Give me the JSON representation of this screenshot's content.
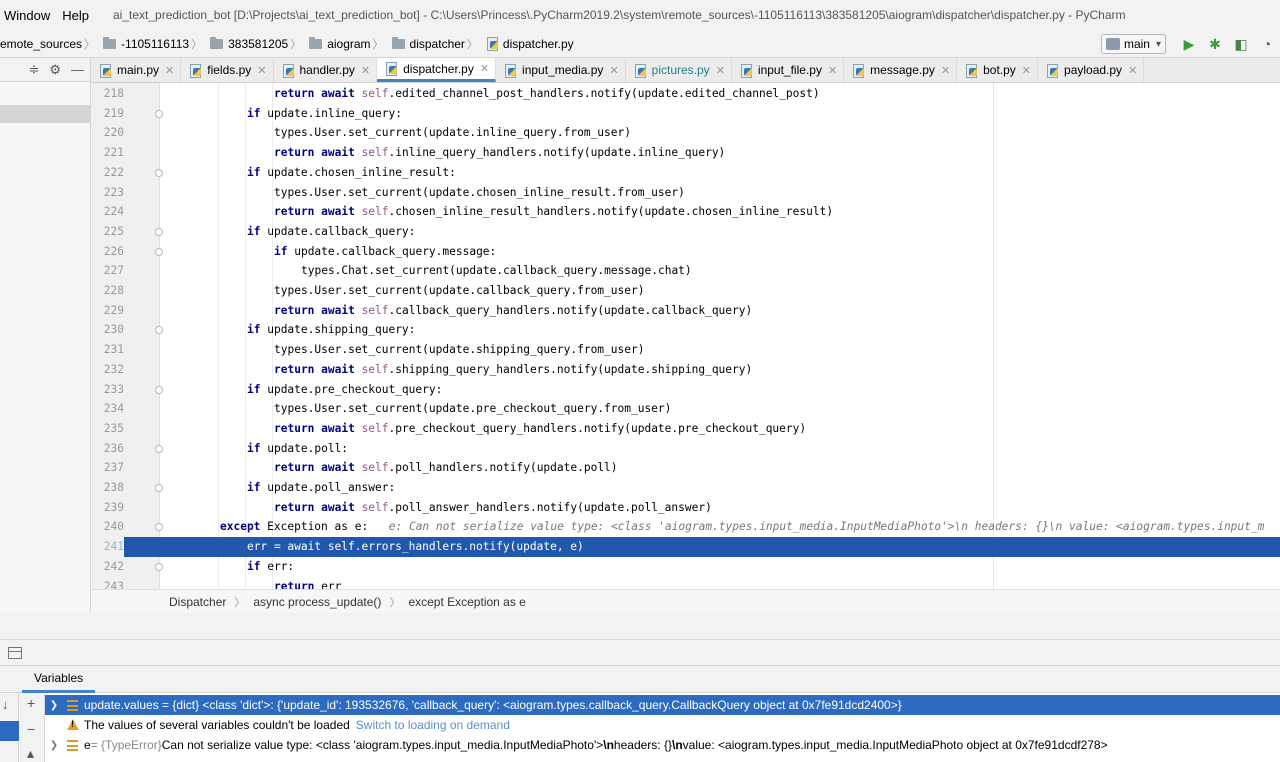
{
  "menu": {
    "items": [
      "Window",
      "Help"
    ],
    "window_title": "ai_text_prediction_bot [D:\\Projects\\ai_text_prediction_bot] - C:\\Users\\Princess\\.PyCharm2019.2\\system\\remote_sources\\-1105116113\\383581205\\aiogram\\dispatcher\\dispatcher.py - PyCharm"
  },
  "nav": {
    "crumbs": [
      "emote_sources",
      "-1105116113",
      "383581205",
      "aiogram",
      "dispatcher",
      "dispatcher.py"
    ],
    "branch": "main"
  },
  "tabs": [
    {
      "label": "main.py",
      "active": false,
      "cyan": false
    },
    {
      "label": "fields.py",
      "active": false,
      "cyan": false
    },
    {
      "label": "handler.py",
      "active": false,
      "cyan": false
    },
    {
      "label": "dispatcher.py",
      "active": true,
      "cyan": false
    },
    {
      "label": "input_media.py",
      "active": false,
      "cyan": false
    },
    {
      "label": "pictures.py",
      "active": false,
      "cyan": true
    },
    {
      "label": "input_file.py",
      "active": false,
      "cyan": false
    },
    {
      "label": "message.py",
      "active": false,
      "cyan": false
    },
    {
      "label": "bot.py",
      "active": false,
      "cyan": false
    },
    {
      "label": "payload.py",
      "active": false,
      "cyan": false
    }
  ],
  "code": {
    "current_line": 241,
    "lines": [
      {
        "n": 218,
        "indent": 16,
        "kw": "return await ",
        "self": true,
        "rest": ".edited_channel_post_handlers.notify(update.edited_channel_post)"
      },
      {
        "n": 219,
        "indent": 12,
        "kw": "if ",
        "self": false,
        "rest": "update.inline_query:"
      },
      {
        "n": 220,
        "indent": 16,
        "kw": "",
        "self": false,
        "rest": "types.User.set_current(update.inline_query.from_user)"
      },
      {
        "n": 221,
        "indent": 16,
        "kw": "return await ",
        "self": true,
        "rest": ".inline_query_handlers.notify(update.inline_query)"
      },
      {
        "n": 222,
        "indent": 12,
        "kw": "if ",
        "self": false,
        "rest": "update.chosen_inline_result:"
      },
      {
        "n": 223,
        "indent": 16,
        "kw": "",
        "self": false,
        "rest": "types.User.set_current(update.chosen_inline_result.from_user)"
      },
      {
        "n": 224,
        "indent": 16,
        "kw": "return await ",
        "self": true,
        "rest": ".chosen_inline_result_handlers.notify(update.chosen_inline_result)"
      },
      {
        "n": 225,
        "indent": 12,
        "kw": "if ",
        "self": false,
        "rest": "update.callback_query:"
      },
      {
        "n": 226,
        "indent": 16,
        "kw": "if ",
        "self": false,
        "rest": "update.callback_query.message:"
      },
      {
        "n": 227,
        "indent": 20,
        "kw": "",
        "self": false,
        "rest": "types.Chat.set_current(update.callback_query.message.chat)"
      },
      {
        "n": 228,
        "indent": 16,
        "kw": "",
        "self": false,
        "rest": "types.User.set_current(update.callback_query.from_user)"
      },
      {
        "n": 229,
        "indent": 16,
        "kw": "return await ",
        "self": true,
        "rest": ".callback_query_handlers.notify(update.callback_query)"
      },
      {
        "n": 230,
        "indent": 12,
        "kw": "if ",
        "self": false,
        "rest": "update.shipping_query:"
      },
      {
        "n": 231,
        "indent": 16,
        "kw": "",
        "self": false,
        "rest": "types.User.set_current(update.shipping_query.from_user)"
      },
      {
        "n": 232,
        "indent": 16,
        "kw": "return await ",
        "self": true,
        "rest": ".shipping_query_handlers.notify(update.shipping_query)"
      },
      {
        "n": 233,
        "indent": 12,
        "kw": "if ",
        "self": false,
        "rest": "update.pre_checkout_query:"
      },
      {
        "n": 234,
        "indent": 16,
        "kw": "",
        "self": false,
        "rest": "types.User.set_current(update.pre_checkout_query.from_user)"
      },
      {
        "n": 235,
        "indent": 16,
        "kw": "return await ",
        "self": true,
        "rest": ".pre_checkout_query_handlers.notify(update.pre_checkout_query)"
      },
      {
        "n": 236,
        "indent": 12,
        "kw": "if ",
        "self": false,
        "rest": "update.poll:"
      },
      {
        "n": 237,
        "indent": 16,
        "kw": "return await ",
        "self": true,
        "rest": ".poll_handlers.notify(update.poll)"
      },
      {
        "n": 238,
        "indent": 12,
        "kw": "if ",
        "self": false,
        "rest": "update.poll_answer:"
      },
      {
        "n": 239,
        "indent": 16,
        "kw": "return await ",
        "self": true,
        "rest": ".poll_answer_handlers.notify(update.poll_answer)"
      },
      {
        "n": 240,
        "indent": 8,
        "kw": "except ",
        "self": false,
        "rest": "Exception as e:",
        "hint": "e: Can not serialize value type: <class 'aiogram.types.input_media.InputMediaPhoto'>\\n headers: {}\\n value: <aiogram.types.input_m"
      },
      {
        "n": 241,
        "indent": 12,
        "kw": "",
        "self": false,
        "rest": "err = await self.errors_handlers.notify(update, e)"
      },
      {
        "n": 242,
        "indent": 12,
        "kw": "if ",
        "self": false,
        "rest": "err:"
      },
      {
        "n": 243,
        "indent": 16,
        "kw": "return ",
        "self": false,
        "rest": "err"
      }
    ]
  },
  "breadcrumb": [
    "Dispatcher",
    "async process_update()",
    "except Exception as e"
  ],
  "debug": {
    "vars_tab": "Variables",
    "rows": [
      {
        "kind": "var",
        "selected": true,
        "text": "update.values = {dict} <class 'dict'>: {'update_id': 193532676, 'callback_query': <aiogram.types.callback_query.CallbackQuery object at 0x7fe91dcd2400>}"
      },
      {
        "kind": "warn",
        "text": "The values of several variables couldn't be loaded",
        "link": "Switch to loading on demand"
      },
      {
        "kind": "var",
        "selected": false,
        "name": "e",
        "type": " = {TypeError} ",
        "text": "Can not serialize value type: <class 'aiogram.types.input_media.InputMediaPhoto'>",
        "esc1": "\\n",
        "mid": " headers: {}",
        "esc2": "\\n",
        "tail": " value: <aiogram.types.input_media.InputMediaPhoto object at 0x7fe91dcdf278>"
      }
    ]
  },
  "colors": {
    "accent": "#2158ad",
    "keyword": "#000080",
    "self": "#94558d"
  }
}
